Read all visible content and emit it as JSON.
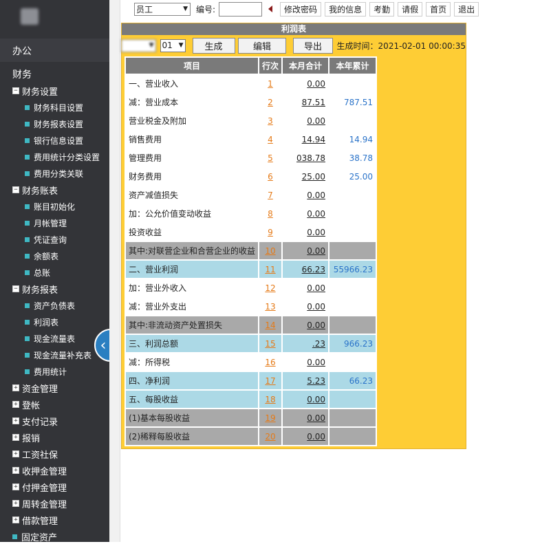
{
  "sidebar": {
    "office": "办公",
    "finance": "财务",
    "tree": [
      {
        "label": "财务设置",
        "level": 1,
        "toggle": "−"
      },
      {
        "label": "财务科目设置",
        "level": 2
      },
      {
        "label": "财务报表设置",
        "level": 2
      },
      {
        "label": "银行信息设置",
        "level": 2
      },
      {
        "label": "费用统计分类设置",
        "level": 2
      },
      {
        "label": "费用分类关联",
        "level": 2
      },
      {
        "label": "财务账表",
        "level": 1,
        "toggle": "−"
      },
      {
        "label": "账目初始化",
        "level": 2
      },
      {
        "label": "月帐管理",
        "level": 2
      },
      {
        "label": "凭证查询",
        "level": 2
      },
      {
        "label": "余额表",
        "level": 2
      },
      {
        "label": "总账",
        "level": 2
      },
      {
        "label": "财务报表",
        "level": 1,
        "toggle": "−"
      },
      {
        "label": "资产负债表",
        "level": 2
      },
      {
        "label": "利润表",
        "level": 2
      },
      {
        "label": "现金流量表",
        "level": 2
      },
      {
        "label": "现金流量补充表",
        "level": 2
      },
      {
        "label": "费用统计",
        "level": 2
      },
      {
        "label": "资金管理",
        "level": 1,
        "toggle": "+"
      },
      {
        "label": "登帐",
        "level": 1,
        "toggle": "+"
      },
      {
        "label": "支付记录",
        "level": 1,
        "toggle": "+"
      },
      {
        "label": "报销",
        "level": 1,
        "toggle": "+"
      },
      {
        "label": "工资社保",
        "level": 1,
        "toggle": "+"
      },
      {
        "label": "收押金管理",
        "level": 1,
        "toggle": "+"
      },
      {
        "label": "付押金管理",
        "level": 1,
        "toggle": "+"
      },
      {
        "label": "周转金管理",
        "level": 1,
        "toggle": "+"
      },
      {
        "label": "借款管理",
        "level": 1,
        "toggle": "+"
      },
      {
        "label": "固定资产",
        "level": 1,
        "toggle": "leaf"
      }
    ],
    "collapse_glyph": "‹"
  },
  "toolbar": {
    "employee_select": "员工",
    "id_label": "编号:",
    "id_value": "",
    "buttons": [
      "修改密码",
      "我的信息",
      "考勤",
      "请假",
      "首页",
      "退出"
    ]
  },
  "report": {
    "title": "利润表",
    "month_select": "01",
    "generate_btn": "生成",
    "edit_btn": "编辑",
    "export_btn": "导出",
    "generated_time": "生成时间：2021-02-01 00:00:35",
    "headers": [
      "项目",
      "行次",
      "本月合计",
      "本年累计"
    ],
    "rows": [
      {
        "item": "一、营业收入",
        "line": "1",
        "month": "0.00",
        "year": "",
        "style": "white"
      },
      {
        "item": "减：营业成本",
        "line": "2",
        "month": "87.51",
        "year": "787.51",
        "style": "white"
      },
      {
        "item": "营业税金及附加",
        "line": "3",
        "month": "0.00",
        "year": "",
        "style": "white"
      },
      {
        "item": "销售费用",
        "line": "4",
        "month": "14.94",
        "year": "14.94",
        "style": "white"
      },
      {
        "item": "管理费用",
        "line": "5",
        "month": "038.78",
        "year": "38.78",
        "style": "white"
      },
      {
        "item": "财务费用",
        "line": "6",
        "month": "25.00",
        "year": "25.00",
        "style": "white"
      },
      {
        "item": "资产减值损失",
        "line": "7",
        "month": "0.00",
        "year": "",
        "style": "white"
      },
      {
        "item": "加：公允价值变动收益",
        "line": "8",
        "month": "0.00",
        "year": "",
        "style": "white"
      },
      {
        "item": "投资收益",
        "line": "9",
        "month": "0.00",
        "year": "",
        "style": "white"
      },
      {
        "item": "其中:对联营企业和合营企业的收益",
        "line": "10",
        "month": "0.00",
        "year": "",
        "style": "gray"
      },
      {
        "item": "二、营业利润",
        "line": "11",
        "month": "66.23",
        "year": "55966.23",
        "style": "blue"
      },
      {
        "item": "加：营业外收入",
        "line": "12",
        "month": "0.00",
        "year": "",
        "style": "white"
      },
      {
        "item": "减：营业外支出",
        "line": "13",
        "month": "0.00",
        "year": "",
        "style": "white"
      },
      {
        "item": "其中:非流动资产处置损失",
        "line": "14",
        "month": "0.00",
        "year": "",
        "style": "gray"
      },
      {
        "item": "三、利润总额",
        "line": "15",
        "month": ".23",
        "year": "966.23",
        "style": "blue"
      },
      {
        "item": "减：所得税",
        "line": "16",
        "month": "0.00",
        "year": "",
        "style": "white"
      },
      {
        "item": "四、净利润",
        "line": "17",
        "month": "5.23",
        "year": "66.23",
        "style": "blue"
      },
      {
        "item": "五、每股收益",
        "line": "18",
        "month": "0.00",
        "year": "",
        "style": "blue"
      },
      {
        "item": "(1)基本每股收益",
        "line": "19",
        "month": "0.00",
        "year": "",
        "style": "gray"
      },
      {
        "item": "(2)稀释每股收益",
        "line": "20",
        "month": "0.00",
        "year": "",
        "style": "gray"
      }
    ]
  }
}
